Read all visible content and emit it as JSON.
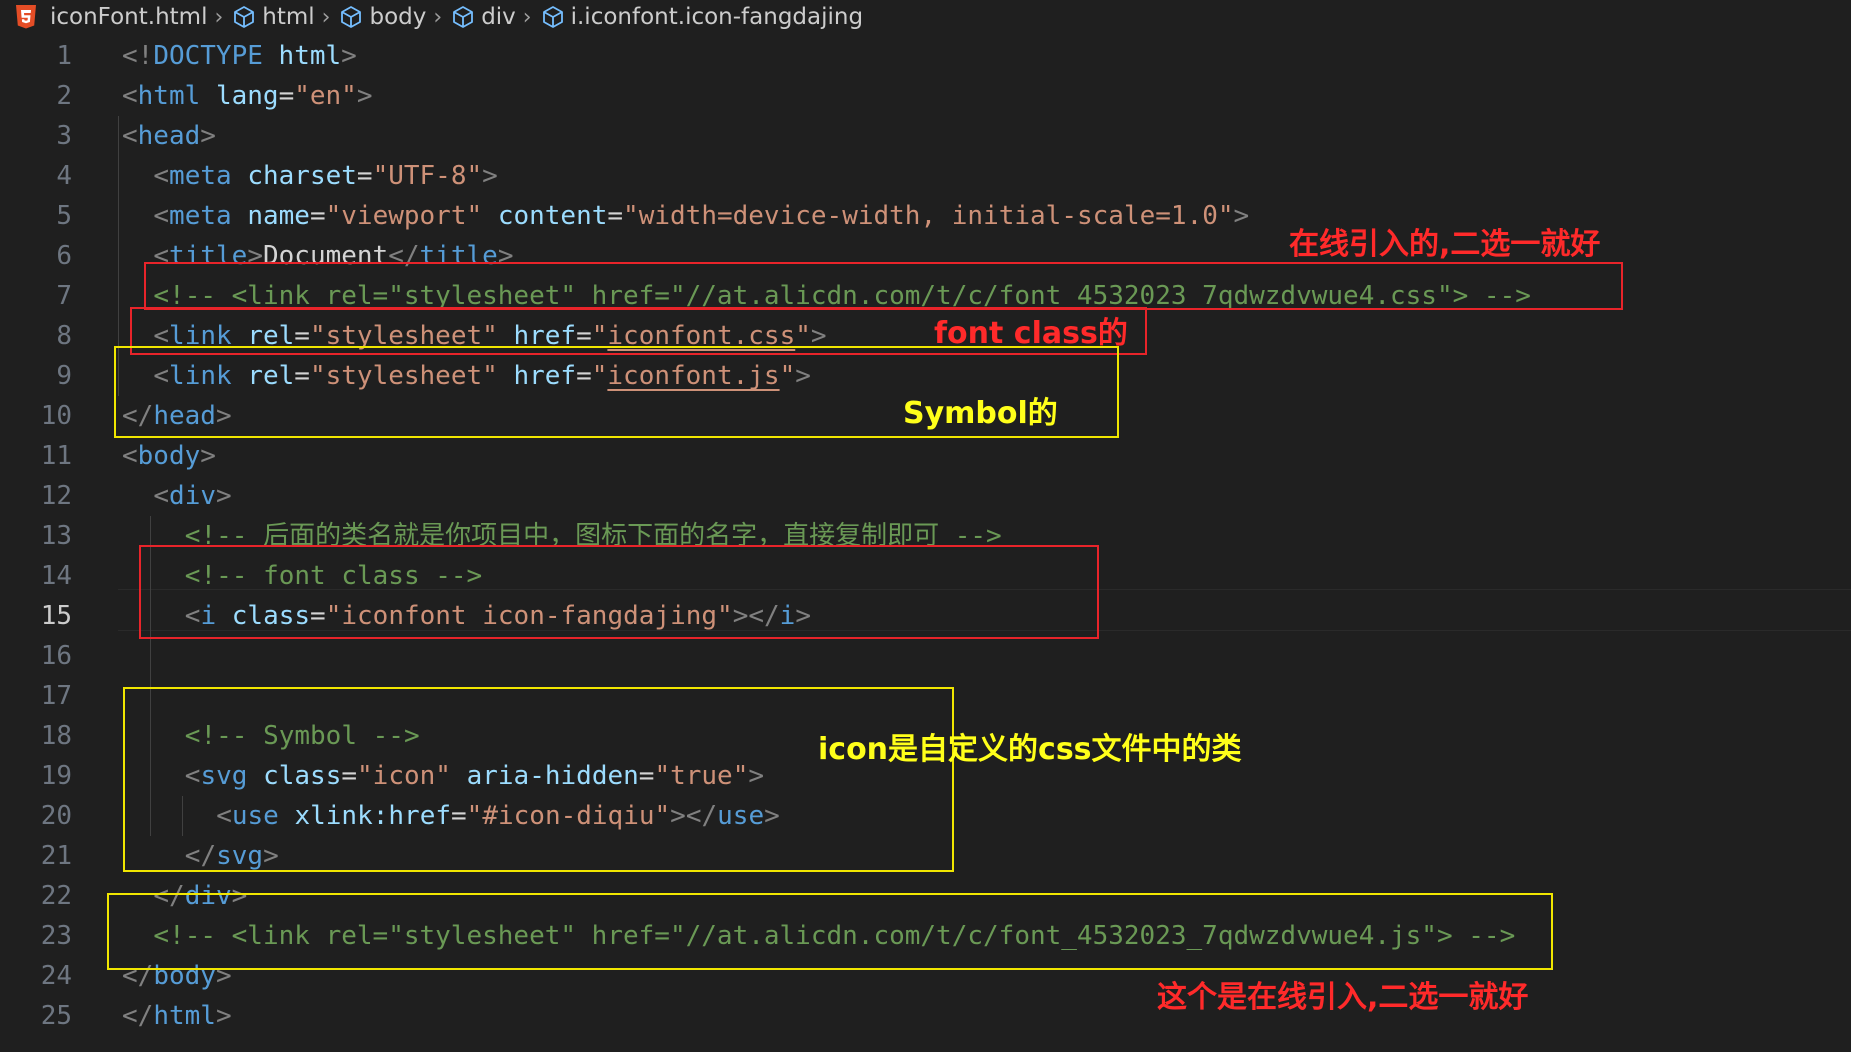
{
  "breadcrumb": {
    "file": "iconFont.html",
    "parts": [
      "html",
      "body",
      "div",
      "i.iconfont.icon-fangdajing"
    ]
  },
  "active_line": 15,
  "lines": [
    {
      "n": "1",
      "tokens": [
        [
          "punc",
          "<!"
        ],
        [
          "tag",
          "DOCTYPE"
        ],
        [
          "txt",
          " "
        ],
        [
          "attr",
          "html"
        ],
        [
          "punc",
          ">"
        ]
      ]
    },
    {
      "n": "2",
      "tokens": [
        [
          "punc",
          "<"
        ],
        [
          "tag",
          "html"
        ],
        [
          "txt",
          " "
        ],
        [
          "attr",
          "lang"
        ],
        [
          "txt",
          "="
        ],
        [
          "str",
          "\"en\""
        ],
        [
          "punc",
          ">"
        ]
      ]
    },
    {
      "n": "3",
      "tokens": [
        [
          "punc",
          "<"
        ],
        [
          "tag",
          "head"
        ],
        [
          "punc",
          ">"
        ]
      ]
    },
    {
      "n": "4",
      "tokens": [
        [
          "punc",
          "<"
        ],
        [
          "tag",
          "meta"
        ],
        [
          "txt",
          " "
        ],
        [
          "attr",
          "charset"
        ],
        [
          "txt",
          "="
        ],
        [
          "str",
          "\"UTF-8\""
        ],
        [
          "punc",
          ">"
        ]
      ]
    },
    {
      "n": "5",
      "tokens": [
        [
          "punc",
          "<"
        ],
        [
          "tag",
          "meta"
        ],
        [
          "txt",
          " "
        ],
        [
          "attr",
          "name"
        ],
        [
          "txt",
          "="
        ],
        [
          "str",
          "\"viewport\""
        ],
        [
          "txt",
          " "
        ],
        [
          "attr",
          "content"
        ],
        [
          "txt",
          "="
        ],
        [
          "str",
          "\"width=device-width, initial-scale=1.0\""
        ],
        [
          "punc",
          ">"
        ]
      ]
    },
    {
      "n": "6",
      "tokens": [
        [
          "punc",
          "<"
        ],
        [
          "tag",
          "title"
        ],
        [
          "punc",
          ">"
        ],
        [
          "txt",
          "Document"
        ],
        [
          "punc",
          "</"
        ],
        [
          "tag",
          "title"
        ],
        [
          "punc",
          ">"
        ]
      ]
    },
    {
      "n": "7",
      "tokens": [
        [
          "cmt",
          "<!-- <link rel=\"stylesheet\" href=\"//at.alicdn.com/t/c/font_4532023_7qdwzdvwue4.css\"> -->"
        ]
      ]
    },
    {
      "n": "8",
      "tokens": [
        [
          "punc",
          "<"
        ],
        [
          "tag",
          "link"
        ],
        [
          "txt",
          " "
        ],
        [
          "attr",
          "rel"
        ],
        [
          "txt",
          "="
        ],
        [
          "str",
          "\"stylesheet\""
        ],
        [
          "txt",
          " "
        ],
        [
          "attr",
          "href"
        ],
        [
          "txt",
          "="
        ],
        [
          "str",
          "\""
        ],
        [
          "stru",
          "iconfont.css"
        ],
        [
          "str",
          "\""
        ],
        [
          "punc",
          ">"
        ]
      ]
    },
    {
      "n": "9",
      "tokens": [
        [
          "punc",
          "<"
        ],
        [
          "tag",
          "link"
        ],
        [
          "txt",
          " "
        ],
        [
          "attr",
          "rel"
        ],
        [
          "txt",
          "="
        ],
        [
          "str",
          "\"stylesheet\""
        ],
        [
          "txt",
          " "
        ],
        [
          "attr",
          "href"
        ],
        [
          "txt",
          "="
        ],
        [
          "str",
          "\""
        ],
        [
          "stru",
          "iconfont.js"
        ],
        [
          "str",
          "\""
        ],
        [
          "punc",
          ">"
        ]
      ]
    },
    {
      "n": "10",
      "tokens": [
        [
          "punc",
          "</"
        ],
        [
          "tag",
          "head"
        ],
        [
          "punc",
          ">"
        ]
      ]
    },
    {
      "n": "11",
      "tokens": [
        [
          "punc",
          "<"
        ],
        [
          "tag",
          "body"
        ],
        [
          "punc",
          ">"
        ]
      ]
    },
    {
      "n": "12",
      "tokens": [
        [
          "punc",
          "<"
        ],
        [
          "tag",
          "div"
        ],
        [
          "punc",
          ">"
        ]
      ]
    },
    {
      "n": "13",
      "tokens": [
        [
          "cmt",
          "<!-- 后面的类名就是你项目中，图标下面的名字，直接复制即可 -->"
        ]
      ]
    },
    {
      "n": "14",
      "tokens": [
        [
          "cmt",
          "<!-- font class -->"
        ]
      ]
    },
    {
      "n": "15",
      "tokens": [
        [
          "punc",
          "<"
        ],
        [
          "tag",
          "i"
        ],
        [
          "txt",
          " "
        ],
        [
          "attr",
          "class"
        ],
        [
          "txt",
          "="
        ],
        [
          "str",
          "\"iconfont icon-fangdajing\""
        ],
        [
          "punc",
          "></"
        ],
        [
          "tag",
          "i"
        ],
        [
          "punc",
          ">"
        ]
      ]
    },
    {
      "n": "16",
      "tokens": []
    },
    {
      "n": "17",
      "tokens": []
    },
    {
      "n": "18",
      "tokens": [
        [
          "cmt",
          "<!-- Symbol -->"
        ]
      ]
    },
    {
      "n": "19",
      "tokens": [
        [
          "punc",
          "<"
        ],
        [
          "tag",
          "svg"
        ],
        [
          "txt",
          " "
        ],
        [
          "attr",
          "class"
        ],
        [
          "txt",
          "="
        ],
        [
          "str",
          "\"icon\""
        ],
        [
          "txt",
          " "
        ],
        [
          "attr",
          "aria-hidden"
        ],
        [
          "txt",
          "="
        ],
        [
          "str",
          "\"true\""
        ],
        [
          "punc",
          ">"
        ]
      ]
    },
    {
      "n": "20",
      "tokens": [
        [
          "punc",
          "<"
        ],
        [
          "tag",
          "use"
        ],
        [
          "txt",
          " "
        ],
        [
          "attr",
          "xlink:href"
        ],
        [
          "txt",
          "="
        ],
        [
          "str",
          "\"#icon-diqiu\""
        ],
        [
          "punc",
          "></"
        ],
        [
          "tag",
          "use"
        ],
        [
          "punc",
          ">"
        ]
      ]
    },
    {
      "n": "21",
      "tokens": [
        [
          "punc",
          "</"
        ],
        [
          "tag",
          "svg"
        ],
        [
          "punc",
          ">"
        ]
      ]
    },
    {
      "n": "22",
      "tokens": [
        [
          "punc",
          "</"
        ],
        [
          "tag",
          "div"
        ],
        [
          "punc",
          ">"
        ]
      ]
    },
    {
      "n": "23",
      "tokens": [
        [
          "cmt",
          "<!-- <link rel=\"stylesheet\" href=\"//at.alicdn.com/t/c/font_4532023_7qdwzdvwue4.js\"> -->"
        ]
      ]
    },
    {
      "n": "24",
      "tokens": [
        [
          "punc",
          "</"
        ],
        [
          "tag",
          "body"
        ],
        [
          "punc",
          ">"
        ]
      ]
    },
    {
      "n": "25",
      "tokens": [
        [
          "punc",
          "</"
        ],
        [
          "tag",
          "html"
        ],
        [
          "punc",
          ">"
        ]
      ]
    }
  ],
  "annotations": [
    {
      "text": "在线引入的,二选一就好",
      "color": "#ff2a2a"
    },
    {
      "text": "font class的",
      "color": "#ff2a2a"
    },
    {
      "text": "Symbol的",
      "color": "#ffff1a"
    },
    {
      "text": "icon是自定义的css文件中的类",
      "color": "#ffff1a"
    },
    {
      "text": "这个是在线引入,二选一就好",
      "color": "#ff2a2a"
    }
  ],
  "colors": {
    "background": "#1f1f1f",
    "tag": "#569cd6",
    "attr": "#9cdcfe",
    "string": "#ce9178",
    "comment": "#6a9955",
    "punctuation": "#808080",
    "red_box": "#e8242a",
    "yellow_box": "#f0e600"
  }
}
